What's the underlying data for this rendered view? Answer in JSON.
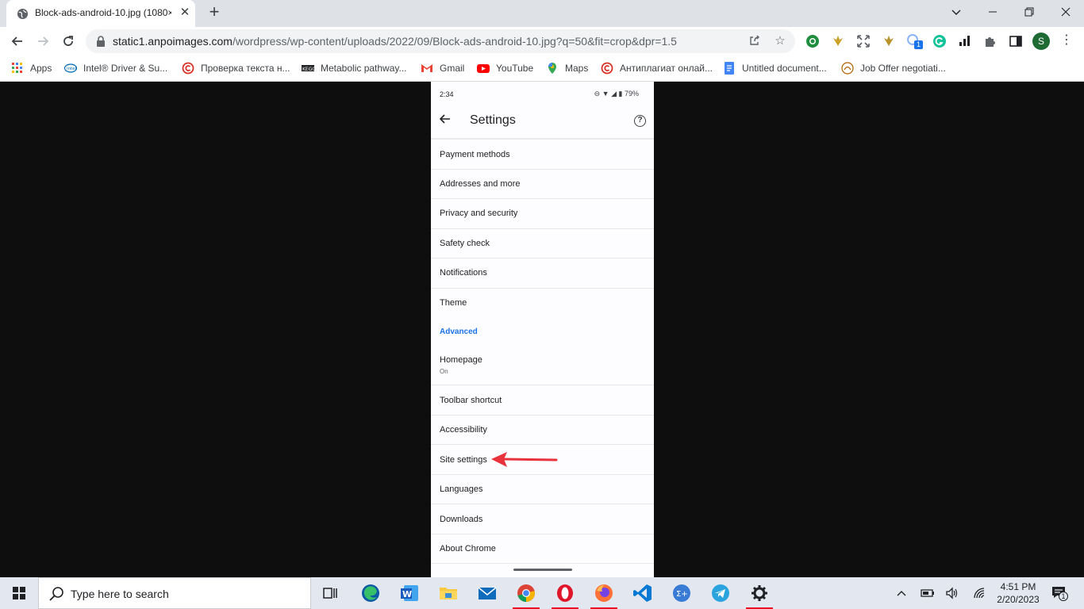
{
  "browser": {
    "tab": {
      "title": "Block-ads-android-10.jpg (1080×"
    },
    "url": {
      "host": "static1.anpoimages.com",
      "path": "/wordpress/wp-content/uploads/2022/09/Block-ads-android-10.jpg?q=50&fit=crop&dpr=1.5"
    },
    "profile_initial": "S",
    "extension_badge": "1",
    "bookmarks": [
      {
        "label": "Apps"
      },
      {
        "label": "Intel® Driver & Su..."
      },
      {
        "label": "Проверка текста н..."
      },
      {
        "label": "Metabolic pathway..."
      },
      {
        "label": "Gmail"
      },
      {
        "label": "YouTube"
      },
      {
        "label": "Maps"
      },
      {
        "label": "Антиплагиат онлай..."
      },
      {
        "label": "Untitled document..."
      },
      {
        "label": "Job Offer negotiati..."
      }
    ]
  },
  "phone": {
    "status": {
      "time": "2:34",
      "battery": "79%"
    },
    "appbar": {
      "title": "Settings"
    },
    "items": [
      {
        "label": "Payment methods"
      },
      {
        "label": "Addresses and more"
      },
      {
        "label": "Privacy and security"
      },
      {
        "label": "Safety check"
      },
      {
        "label": "Notifications"
      },
      {
        "label": "Theme"
      }
    ],
    "section_advanced": "Advanced",
    "homepage": {
      "label": "Homepage",
      "sub": "On"
    },
    "items2": [
      {
        "label": "Toolbar shortcut"
      },
      {
        "label": "Accessibility"
      },
      {
        "label": "Site settings"
      },
      {
        "label": "Languages"
      },
      {
        "label": "Downloads"
      },
      {
        "label": "About Chrome"
      }
    ],
    "arrow_color": "#e8323c"
  },
  "taskbar": {
    "search_placeholder": "Type here to search",
    "time": "4:51 PM",
    "date": "2/20/2023",
    "notification_count": "1"
  }
}
